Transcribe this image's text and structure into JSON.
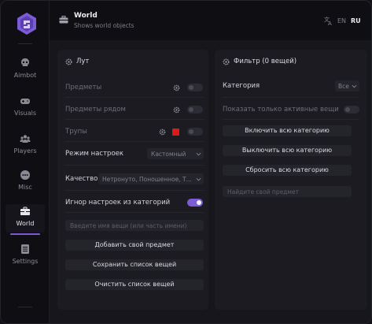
{
  "header": {
    "title": "World",
    "subtitle": "Shows world objects",
    "languages": [
      "EN",
      "RU"
    ],
    "active_language": "RU"
  },
  "sidebar": {
    "items": [
      {
        "label": "Aimbot",
        "icon": "skull-icon"
      },
      {
        "label": "Visuals",
        "icon": "gamepad-icon"
      },
      {
        "label": "Players",
        "icon": "users-icon"
      },
      {
        "label": "Misc",
        "icon": "dots-circle-icon"
      },
      {
        "label": "World",
        "icon": "toolbox-icon",
        "active": true
      },
      {
        "label": "Settings",
        "icon": "list-icon"
      }
    ]
  },
  "loot_panel": {
    "title": "Лут",
    "rows": {
      "items": "Предметы",
      "items_nearby": "Предметы рядом",
      "corpses": "Трупы",
      "settings_mode": "Режим настроек",
      "settings_mode_value": "Кастомный",
      "quality": "Качество",
      "quality_value": "Нетронуто, Поношенное, Т...",
      "ignore_category": "Игнор настроек из категорий"
    },
    "item_name_placeholder": "Введите имя вещи (или часть имени)",
    "add_item_button": "Добавить свой предмет",
    "save_list_button": "Сохранить список вещей",
    "clear_list_button": "Очистить список вещей",
    "corpse_color": "#e01818"
  },
  "filter_panel": {
    "title": "Фильтр (0 вещей)",
    "category_label": "Категория",
    "category_value": "Все",
    "only_active_label": "Показать только активные вещи",
    "enable_all_button": "Включить всю категорию",
    "disable_all_button": "Выключить всю категорию",
    "reset_all_button": "Сбросить всю категорию",
    "search_placeholder": "Найдите свой предмет"
  },
  "colors": {
    "accent": "#7c5cd6",
    "background": "#0f0f13",
    "panel": "#1b1b21"
  }
}
